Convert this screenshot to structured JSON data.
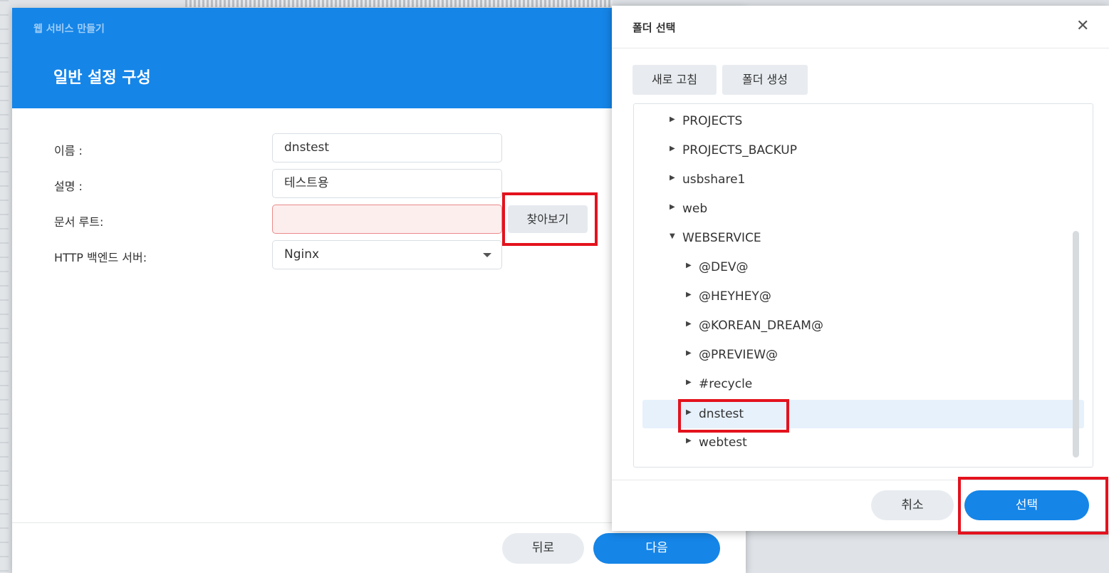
{
  "wizard": {
    "window_title": "웹 서비스 만들기",
    "step_title": "일반 설정 구성",
    "fields": {
      "name": {
        "label": "이름 :",
        "value": "dnstest"
      },
      "description": {
        "label": "설명 :",
        "value": "테스트용"
      },
      "doc_root": {
        "label": "문서 루트:",
        "value": ""
      },
      "http_backend": {
        "label": "HTTP 백엔드 서버:",
        "value": "Nginx"
      }
    },
    "browse_label": "찾아보기",
    "back_label": "뒤로",
    "next_label": "다음"
  },
  "folder_dialog": {
    "title": "폴더 선택",
    "close_icon": "close-icon",
    "refresh_label": "새로 고침",
    "create_folder_label": "폴더 생성",
    "tree": [
      {
        "label": "PROJECTS",
        "level": 0,
        "expanded": false
      },
      {
        "label": "PROJECTS_BACKUP",
        "level": 0,
        "expanded": false
      },
      {
        "label": "usbshare1",
        "level": 0,
        "expanded": false
      },
      {
        "label": "web",
        "level": 0,
        "expanded": false
      },
      {
        "label": "WEBSERVICE",
        "level": 0,
        "expanded": true
      },
      {
        "label": "@DEV@",
        "level": 1,
        "expanded": false
      },
      {
        "label": "@HEYHEY@",
        "level": 1,
        "expanded": false
      },
      {
        "label": "@KOREAN_DREAM@",
        "level": 1,
        "expanded": false
      },
      {
        "label": "@PREVIEW@",
        "level": 1,
        "expanded": false
      },
      {
        "label": "#recycle",
        "level": 1,
        "expanded": false
      },
      {
        "label": "dnstest",
        "level": 1,
        "expanded": false,
        "selected": true
      },
      {
        "label": "webtest",
        "level": 1,
        "expanded": false
      }
    ],
    "cancel_label": "취소",
    "select_label": "선택"
  },
  "colors": {
    "accent": "#1585e8",
    "highlight": "#e3121d",
    "selected_row": "#e6f1fc"
  }
}
